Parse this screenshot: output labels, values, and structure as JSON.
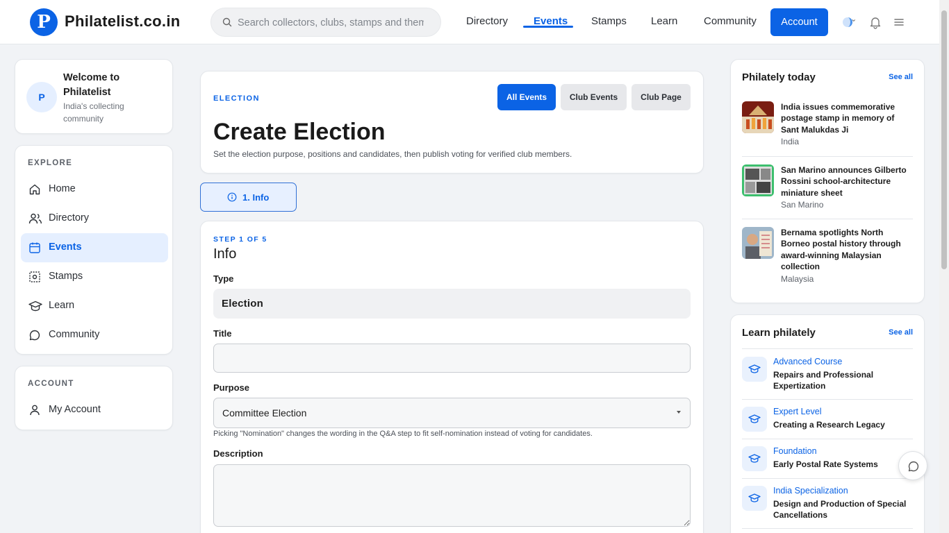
{
  "header": {
    "logo_letter": "P",
    "brand": "Philatelist.co.in",
    "search_placeholder": "Search collectors, clubs, stamps and themes",
    "nav": [
      "Directory",
      "Events",
      "Stamps",
      "Learn",
      "Community"
    ],
    "active_nav": "Events",
    "account_label": "Account",
    "accent_color": "#0b63e5"
  },
  "sidebar": {
    "welcome": {
      "avatar_letter": "P",
      "title": "Welcome to Philatelist",
      "subtitle": "India's collecting community"
    },
    "explore_label": "EXPLORE",
    "items": [
      {
        "label": "Home",
        "icon": "home-icon"
      },
      {
        "label": "Directory",
        "icon": "users-icon"
      },
      {
        "label": "Events",
        "icon": "calendar-icon",
        "active": true
      },
      {
        "label": "Stamps",
        "icon": "stamp-icon"
      },
      {
        "label": "Learn",
        "icon": "graduation-cap-icon"
      },
      {
        "label": "Community",
        "icon": "chat-icon"
      }
    ],
    "account_label": "ACCOUNT",
    "account_items": [
      {
        "label": "My Account",
        "icon": "user-icon"
      }
    ]
  },
  "main": {
    "kicker": "ELECTION",
    "title": "Create Election",
    "subtitle": "Set the election purpose, positions and candidates, then publish voting for verified club members.",
    "pills": [
      "All Events",
      "Club Events",
      "Club Page"
    ],
    "step_tab": "1. Info",
    "form": {
      "step_label": "STEP 1 OF 5",
      "heading": "Info",
      "type_label": "Type",
      "type_value": "Election",
      "title_label": "Title",
      "title_value": "",
      "purpose_label": "Purpose",
      "purpose_value": "Committee Election",
      "purpose_help": "Picking \"Nomination\" changes the wording in the Q&A step to fit self-nomination instead of voting for candidates.",
      "description_label": "Description",
      "description_value": ""
    }
  },
  "right": {
    "today_title": "Philately today",
    "see_all": "See all",
    "news": [
      {
        "title": "India issues commemorative postage stamp in memory of Sant Malukdas Ji",
        "country": "India"
      },
      {
        "title": "San Marino announces Gilberto Rossini school-architecture miniature sheet",
        "country": "San Marino"
      },
      {
        "title": "Bernama spotlights North Borneo postal history through award-winning Malaysian collection",
        "country": "Malaysia"
      }
    ],
    "learn_title": "Learn philately",
    "learn": [
      {
        "category": "Advanced Course",
        "title": "Repairs and Professional Expertization"
      },
      {
        "category": "Expert Level",
        "title": "Creating a Research Legacy"
      },
      {
        "category": "Foundation",
        "title": "Early Postal Rate Systems"
      },
      {
        "category": "India Specialization",
        "title": "Design and Production of Special Cancellations"
      }
    ]
  }
}
